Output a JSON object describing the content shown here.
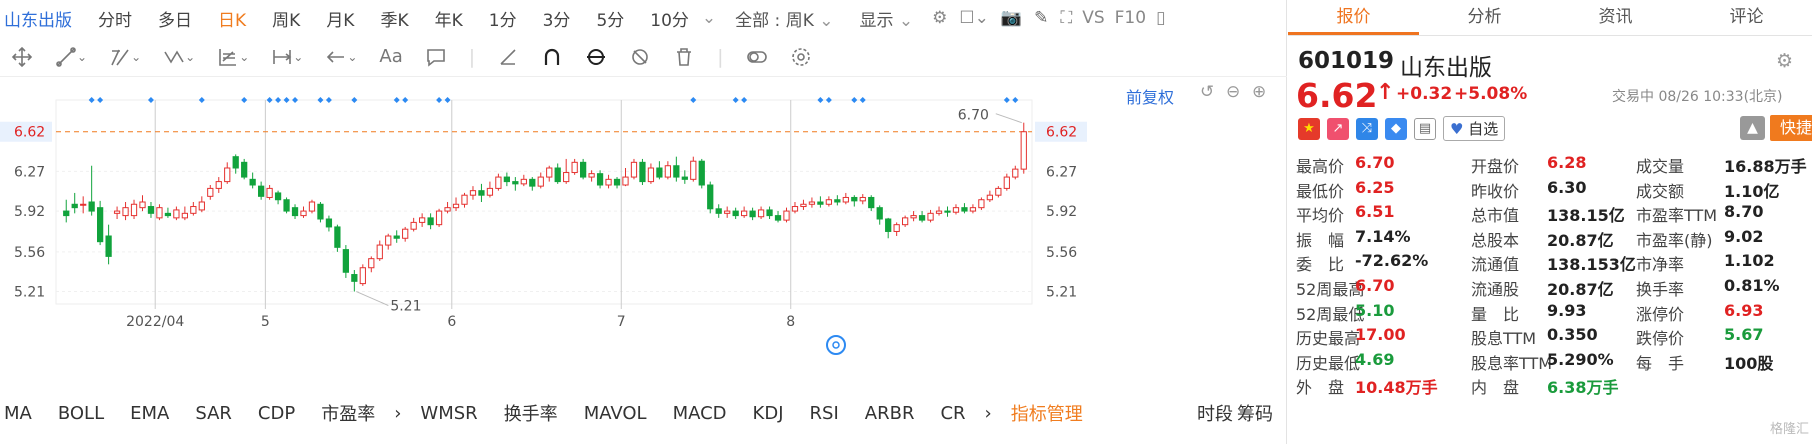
{
  "toolbar1": {
    "title": "山东出版",
    "items": [
      "分时",
      "多日",
      "日K",
      "周K",
      "月K",
      "季K",
      "年K",
      "1分",
      "3分",
      "5分",
      "10分"
    ],
    "selected": "日K",
    "range": "全部 : 周K",
    "display": "显示",
    "vs": "VS",
    "f10": "F10"
  },
  "toolbar2": {
    "aa": "Aa"
  },
  "chart_header": {
    "adjust": "前复权"
  },
  "chart_data": {
    "type": "candlestick",
    "y_ticks": [
      "6.62",
      "6.27",
      "5.92",
      "5.56",
      "5.21"
    ],
    "y_tick_values": [
      6.62,
      6.27,
      5.92,
      5.56,
      5.21
    ],
    "x_ticks": [
      "2022/04",
      "5",
      "6",
      "7",
      "8"
    ],
    "current_price_label": "6.62",
    "high_label": "6.70",
    "low_label": "5.21",
    "ylim": [
      5.1,
      6.9
    ],
    "candles": [
      [
        5.92,
        5.88,
        6.02,
        5.82
      ],
      [
        5.98,
        5.95,
        6.08,
        5.9
      ],
      [
        5.98,
        5.98,
        6.05,
        5.9
      ],
      [
        6.0,
        5.92,
        6.32,
        5.88
      ],
      [
        5.95,
        5.65,
        6.01,
        5.62
      ],
      [
        5.7,
        5.52,
        5.8,
        5.45
      ],
      [
        5.9,
        5.92,
        5.96,
        5.85
      ],
      [
        5.88,
        5.95,
        6.0,
        5.84
      ],
      [
        5.88,
        5.98,
        6.02,
        5.85
      ],
      [
        5.95,
        6.0,
        6.06,
        5.92
      ],
      [
        5.96,
        5.9,
        6.0,
        5.86
      ],
      [
        5.86,
        5.95,
        5.98,
        5.84
      ],
      [
        5.9,
        5.88,
        5.95,
        5.86
      ],
      [
        5.86,
        5.93,
        5.96,
        5.84
      ],
      [
        5.86,
        5.9,
        5.96,
        5.84
      ],
      [
        5.9,
        5.96,
        6.0,
        5.88
      ],
      [
        5.93,
        6.0,
        6.05,
        5.91
      ],
      [
        6.05,
        6.12,
        6.15,
        6.02
      ],
      [
        6.12,
        6.18,
        6.22,
        6.08
      ],
      [
        6.18,
        6.3,
        6.35,
        6.16
      ],
      [
        6.4,
        6.3,
        6.42,
        6.25
      ],
      [
        6.35,
        6.22,
        6.38,
        6.2
      ],
      [
        6.2,
        6.15,
        6.26,
        6.12
      ],
      [
        6.14,
        6.05,
        6.18,
        6.02
      ],
      [
        6.04,
        6.12,
        6.15,
        6.02
      ],
      [
        6.08,
        6.02,
        6.1,
        5.98
      ],
      [
        6.02,
        5.92,
        6.04,
        5.9
      ],
      [
        5.95,
        5.88,
        5.98,
        5.85
      ],
      [
        5.88,
        5.92,
        5.96,
        5.86
      ],
      [
        5.92,
        6.0,
        6.02,
        5.9
      ],
      [
        5.98,
        5.85,
        6.0,
        5.82
      ],
      [
        5.85,
        5.78,
        5.88,
        5.74
      ],
      [
        5.78,
        5.6,
        5.8,
        5.56
      ],
      [
        5.58,
        5.38,
        5.62,
        5.33
      ],
      [
        5.36,
        5.3,
        5.4,
        5.21
      ],
      [
        5.28,
        5.42,
        5.45,
        5.26
      ],
      [
        5.42,
        5.5,
        5.52,
        5.38
      ],
      [
        5.5,
        5.62,
        5.66,
        5.48
      ],
      [
        5.62,
        5.7,
        5.72,
        5.58
      ],
      [
        5.7,
        5.68,
        5.75,
        5.64
      ],
      [
        5.68,
        5.76,
        5.78,
        5.65
      ],
      [
        5.76,
        5.82,
        5.86,
        5.74
      ],
      [
        5.82,
        5.86,
        5.9,
        5.78
      ],
      [
        5.86,
        5.8,
        5.9,
        5.76
      ],
      [
        5.8,
        5.92,
        5.94,
        5.78
      ],
      [
        5.92,
        5.95,
        6.0,
        5.9
      ],
      [
        5.95,
        5.98,
        6.04,
        5.92
      ],
      [
        5.98,
        6.06,
        6.08,
        5.95
      ],
      [
        6.06,
        6.1,
        6.14,
        6.02
      ],
      [
        6.1,
        6.06,
        6.16,
        6.0
      ],
      [
        6.06,
        6.12,
        6.18,
        6.04
      ],
      [
        6.12,
        6.22,
        6.25,
        6.1
      ],
      [
        6.22,
        6.18,
        6.26,
        6.14
      ],
      [
        6.18,
        6.16,
        6.22,
        6.1
      ],
      [
        6.16,
        6.2,
        6.24,
        6.14
      ],
      [
        6.2,
        6.14,
        6.22,
        6.1
      ],
      [
        6.14,
        6.22,
        6.26,
        6.12
      ],
      [
        6.22,
        6.3,
        6.32,
        6.18
      ],
      [
        6.3,
        6.18,
        6.34,
        6.16
      ],
      [
        6.18,
        6.26,
        6.38,
        6.16
      ],
      [
        6.26,
        6.35,
        6.38,
        6.24
      ],
      [
        6.35,
        6.22,
        6.38,
        6.2
      ],
      [
        6.22,
        6.25,
        6.28,
        6.18
      ],
      [
        6.25,
        6.15,
        6.28,
        6.12
      ],
      [
        6.15,
        6.2,
        6.24,
        6.12
      ],
      [
        6.2,
        6.15,
        6.22,
        6.12
      ],
      [
        6.15,
        6.22,
        6.3,
        6.14
      ],
      [
        6.22,
        6.35,
        6.38,
        6.2
      ],
      [
        6.35,
        6.18,
        6.38,
        6.15
      ],
      [
        6.18,
        6.3,
        6.34,
        6.16
      ],
      [
        6.3,
        6.22,
        6.36,
        6.2
      ],
      [
        6.22,
        6.32,
        6.36,
        6.2
      ],
      [
        6.32,
        6.22,
        6.4,
        6.18
      ],
      [
        6.22,
        6.2,
        6.28,
        6.16
      ],
      [
        6.2,
        6.36,
        6.4,
        6.18
      ],
      [
        6.36,
        6.15,
        6.38,
        6.12
      ],
      [
        6.15,
        5.94,
        6.18,
        5.9
      ],
      [
        5.94,
        5.9,
        5.98,
        5.86
      ],
      [
        5.9,
        5.92,
        5.96,
        5.86
      ],
      [
        5.92,
        5.88,
        5.95,
        5.85
      ],
      [
        5.88,
        5.92,
        5.96,
        5.86
      ],
      [
        5.92,
        5.87,
        5.95,
        5.84
      ],
      [
        5.87,
        5.93,
        5.96,
        5.85
      ],
      [
        5.93,
        5.88,
        5.96,
        5.85
      ],
      [
        5.88,
        5.84,
        5.92,
        5.82
      ],
      [
        5.84,
        5.92,
        5.95,
        5.82
      ],
      [
        5.92,
        5.96,
        6.0,
        5.9
      ],
      [
        5.96,
        5.98,
        6.02,
        5.93
      ],
      [
        5.98,
        6.0,
        6.04,
        5.95
      ],
      [
        6.0,
        5.98,
        6.05,
        5.95
      ],
      [
        5.98,
        6.02,
        6.05,
        5.96
      ],
      [
        6.02,
        6.0,
        6.06,
        5.97
      ],
      [
        6.0,
        6.04,
        6.08,
        5.98
      ],
      [
        6.04,
        6.01,
        6.06,
        5.96
      ],
      [
        6.01,
        6.04,
        6.07,
        5.98
      ],
      [
        6.04,
        5.95,
        6.06,
        5.92
      ],
      [
        5.95,
        5.85,
        5.97,
        5.8
      ],
      [
        5.85,
        5.74,
        5.86,
        5.68
      ],
      [
        5.74,
        5.8,
        5.82,
        5.7
      ],
      [
        5.8,
        5.86,
        5.88,
        5.78
      ],
      [
        5.86,
        5.88,
        5.92,
        5.83
      ],
      [
        5.88,
        5.84,
        5.92,
        5.82
      ],
      [
        5.84,
        5.9,
        5.93,
        5.82
      ],
      [
        5.9,
        5.92,
        5.96,
        5.88
      ],
      [
        5.92,
        5.91,
        5.96,
        5.87
      ],
      [
        5.91,
        5.95,
        5.98,
        5.89
      ],
      [
        5.95,
        5.92,
        5.99,
        5.9
      ],
      [
        5.92,
        5.95,
        5.98,
        5.9
      ],
      [
        5.95,
        6.02,
        6.04,
        5.93
      ],
      [
        6.02,
        6.06,
        6.1,
        6.0
      ],
      [
        6.06,
        6.12,
        6.14,
        6.04
      ],
      [
        6.12,
        6.22,
        6.25,
        6.1
      ],
      [
        6.22,
        6.29,
        6.32,
        6.2
      ],
      [
        6.29,
        6.62,
        6.7,
        6.25
      ]
    ],
    "markers": [
      3,
      4,
      10,
      16,
      21,
      24,
      25,
      26,
      27,
      30,
      31,
      34,
      39,
      40,
      44,
      45,
      74,
      79,
      80,
      89,
      90,
      93,
      94,
      111,
      112
    ]
  },
  "quote": {
    "tabs": [
      "报价",
      "分析",
      "资讯",
      "评论"
    ],
    "active_tab": "报价",
    "code": "601019",
    "name": "山东出版",
    "price": "6.62",
    "change": "+0.32",
    "pct": "+5.08%",
    "status": "交易中 08/26 10:33(北京)",
    "watch": "自选",
    "quick_trade": "快捷交易",
    "grid": [
      [
        [
          "最高价",
          "6.70",
          "red"
        ],
        [
          "开盘价",
          "6.28",
          "red"
        ],
        [
          "成交量",
          "16.88万手",
          "dark"
        ]
      ],
      [
        [
          "最低价",
          "6.25",
          "red"
        ],
        [
          "昨收价",
          "6.30",
          "dark"
        ],
        [
          "成交额",
          "1.10亿",
          "dark"
        ]
      ],
      [
        [
          "平均价",
          "6.51",
          "red"
        ],
        [
          "总市值",
          "138.15亿",
          "dark"
        ],
        [
          "市盈率TTM",
          "8.70",
          "dark"
        ]
      ],
      [
        [
          "振　幅",
          "7.14%",
          "dark"
        ],
        [
          "总股本",
          "20.87亿",
          "dark"
        ],
        [
          "市盈率(静)",
          "9.02",
          "dark"
        ]
      ],
      [
        [
          "委　比",
          "-72.62%",
          "dark"
        ],
        [
          "流通值",
          "138.153亿",
          "dark"
        ],
        [
          "市净率",
          "1.102",
          "dark"
        ]
      ],
      [
        [
          "52周最高",
          "6.70",
          "red"
        ],
        [
          "流通股",
          "20.87亿",
          "dark"
        ],
        [
          "换手率",
          "0.81%",
          "dark"
        ]
      ],
      [
        [
          "52周最低",
          "5.10",
          "grn"
        ],
        [
          "量　比",
          "9.93",
          "dark"
        ],
        [
          "涨停价",
          "6.93",
          "red"
        ]
      ],
      [
        [
          "历史最高",
          "17.00",
          "red"
        ],
        [
          "股息TTM",
          "0.350",
          "dark"
        ],
        [
          "跌停价",
          "5.67",
          "grn"
        ]
      ],
      [
        [
          "历史最低",
          "4.69",
          "grn"
        ],
        [
          "股息率TTM",
          "5.290%",
          "dark"
        ],
        [
          "每　手",
          "100股",
          "dark"
        ]
      ],
      [
        [
          "外　盘",
          "10.48万手",
          "red"
        ],
        [
          "内　盘",
          "6.38万手",
          "grn"
        ],
        [
          "",
          "",
          ""
        ]
      ]
    ],
    "watermark": "格隆汇"
  },
  "bottom": {
    "items": [
      "MA",
      "BOLL",
      "EMA",
      "SAR",
      "CDP",
      "市盈率",
      "WMSR",
      "换手率",
      "MAVOL",
      "MACD",
      "KDJ",
      "RSI",
      "ARBR",
      "CR"
    ],
    "indicator_mgmt": "指标管理",
    "right1": "时段",
    "right2": "筹码"
  }
}
